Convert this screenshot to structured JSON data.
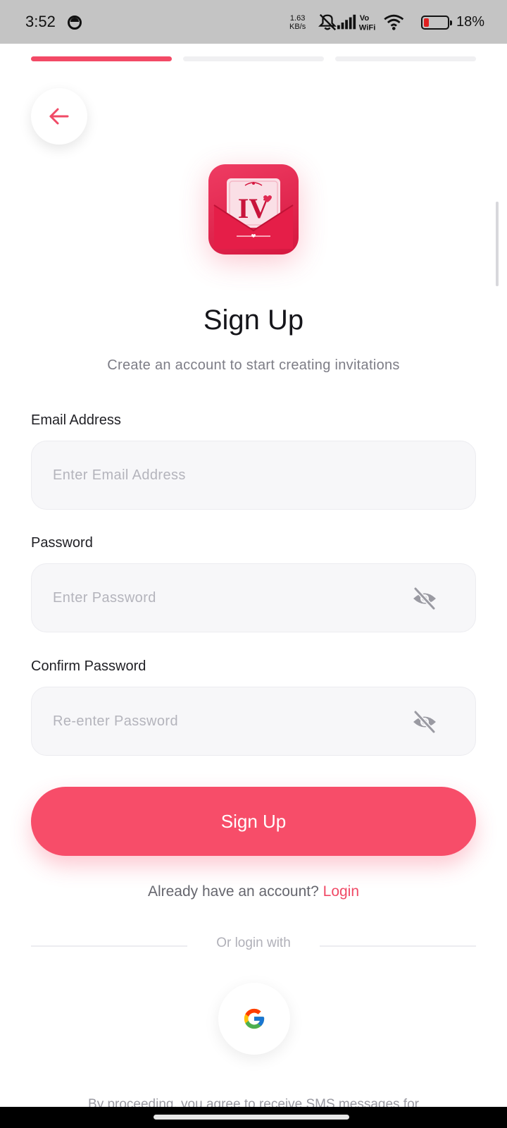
{
  "status_bar": {
    "time": "3:52",
    "speed_value": "1.63",
    "speed_unit": "KB/s",
    "network_label_top": "Vo",
    "network_label_bottom": "WiFi",
    "battery_percent": "18%"
  },
  "progress": {
    "total_steps": 3,
    "current_step": 1,
    "accent_color": "#f34a66"
  },
  "header": {
    "back_icon": "arrow-left-icon"
  },
  "logo": {
    "text": "IV"
  },
  "page": {
    "title": "Sign Up",
    "subtitle": "Create an account to start creating invitations"
  },
  "form": {
    "email": {
      "label": "Email Address",
      "placeholder": "Enter Email Address",
      "value": ""
    },
    "password": {
      "label": "Password",
      "placeholder": "Enter Password",
      "value": "",
      "toggle_icon": "eye-off-icon"
    },
    "confirm_password": {
      "label": "Confirm Password",
      "placeholder": "Re-enter Password",
      "value": "",
      "toggle_icon": "eye-off-icon"
    },
    "submit_label": "Sign Up"
  },
  "footer": {
    "already_text": "Already have an account?",
    "login_link": "Login",
    "divider_text": "Or login with",
    "google_icon": "google-icon",
    "terms_text": "By proceeding, you agree to receive SMS messages for"
  },
  "colors": {
    "primary": "#f74d69",
    "link": "#f04a66",
    "field_bg": "#f7f7f9"
  }
}
